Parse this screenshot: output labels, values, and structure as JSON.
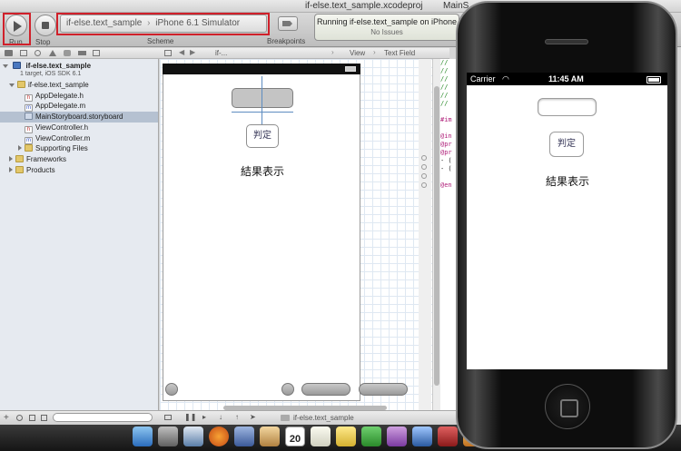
{
  "window": {
    "title": "if-else.text_sample.xcodeproj",
    "title_right": "MainS"
  },
  "toolbar": {
    "run_label": "Run",
    "stop_label": "Stop",
    "scheme_label": "Scheme",
    "scheme_target": "if-else.text_sample",
    "scheme_destination": "iPhone 6.1 Simulator",
    "breakpoints_label": "Breakpoints",
    "activity_status": "Running if-else.text_sample on iPhone",
    "activity_issues": "No Issues"
  },
  "navigator": {
    "project_name": "if-else.text_sample",
    "project_subtitle": "1 target, iOS SDK 6.1",
    "items": [
      {
        "label": "if-else.text_sample",
        "kind": "folder",
        "indent": 1,
        "expanded": true
      },
      {
        "label": "AppDelegate.h",
        "kind": "h",
        "indent": 2
      },
      {
        "label": "AppDelegate.m",
        "kind": "m",
        "indent": 2
      },
      {
        "label": "MainStoryboard.storyboard",
        "kind": "storyboard",
        "indent": 2,
        "selected": true
      },
      {
        "label": "ViewController.h",
        "kind": "h",
        "indent": 2
      },
      {
        "label": "ViewController.m",
        "kind": "m",
        "indent": 2
      },
      {
        "label": "Supporting Files",
        "kind": "folder",
        "indent": 2,
        "expanded": false
      },
      {
        "label": "Frameworks",
        "kind": "folder",
        "indent": 1,
        "expanded": false
      },
      {
        "label": "Products",
        "kind": "folder",
        "indent": 1,
        "expanded": false
      }
    ]
  },
  "jumpbar": {
    "project": "if-...",
    "view": "View",
    "text_field": "Text Field"
  },
  "storyboard": {
    "button_label": "判定",
    "result_label": "結果表示"
  },
  "bottombar": {
    "target": "if-else.text_sample"
  },
  "simulator": {
    "carrier": "Carrier",
    "time": "11:45 AM",
    "button_label": "判定",
    "result_label": "結果表示"
  },
  "dock": {
    "calendar_day": "20"
  },
  "code": {
    "lines": [
      "//",
      "//",
      "//",
      "//",
      "//",
      "//",
      "",
      "#im",
      "",
      "@in",
      "@pr",
      "@pr",
      "- (",
      "- (",
      "",
      "@en"
    ]
  },
  "colors": {
    "highlight_box": "#d0202a",
    "selection": "#b5c1d1",
    "guide": "#5d8cc0"
  }
}
